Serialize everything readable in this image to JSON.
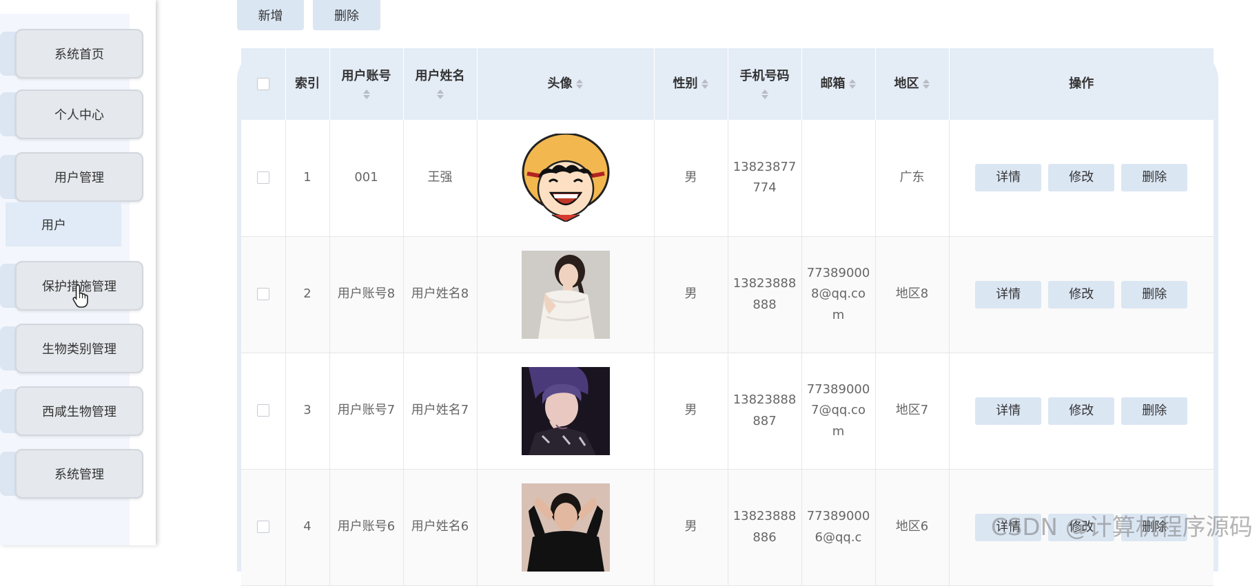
{
  "sidebar": {
    "items": [
      {
        "label": "系统首页"
      },
      {
        "label": "个人中心"
      },
      {
        "label": "用户管理"
      },
      {
        "label": "保护措施管理"
      },
      {
        "label": "生物类别管理"
      },
      {
        "label": "西咸生物管理"
      },
      {
        "label": "系统管理"
      }
    ],
    "submenu": {
      "label": "用户"
    }
  },
  "toolbar": {
    "add_label": "新增",
    "delete_label": "删除"
  },
  "table": {
    "headers": {
      "index": "索引",
      "account": "用户账号",
      "name": "用户姓名",
      "avatar": "头像",
      "gender": "性别",
      "phone": "手机号码",
      "email": "邮箱",
      "region": "地区",
      "actions": "操作"
    },
    "rows": [
      {
        "index": "1",
        "account": "001",
        "name": "王强",
        "avatar": "cartoon-straw-hat-avatar",
        "gender": "男",
        "phone": "13823877774",
        "email": "",
        "region": "广东"
      },
      {
        "index": "2",
        "account": "用户账号8",
        "name": "用户姓名8",
        "avatar": "woman-white-dress-avatar",
        "gender": "男",
        "phone": "13823888888",
        "email": "773890008@qq.com",
        "region": "地区8"
      },
      {
        "index": "3",
        "account": "用户账号7",
        "name": "用户姓名7",
        "avatar": "person-dark-avatar",
        "gender": "男",
        "phone": "13823888887",
        "email": "773890007@qq.com",
        "region": "地区7"
      },
      {
        "index": "4",
        "account": "用户账号6",
        "name": "用户姓名6",
        "avatar": "man-black-shirt-avatar",
        "gender": "男",
        "phone": "13823888886",
        "email": "773890006@qq.c",
        "region": "地区6"
      }
    ],
    "action_labels": {
      "detail": "详情",
      "edit": "修改",
      "delete": "删除"
    }
  },
  "watermark": "CSDN @计算机程序源码",
  "colors": {
    "accent": "#dbe6f3",
    "header_bg": "#e4ecf6",
    "menu_button": "#e5e8ec"
  }
}
